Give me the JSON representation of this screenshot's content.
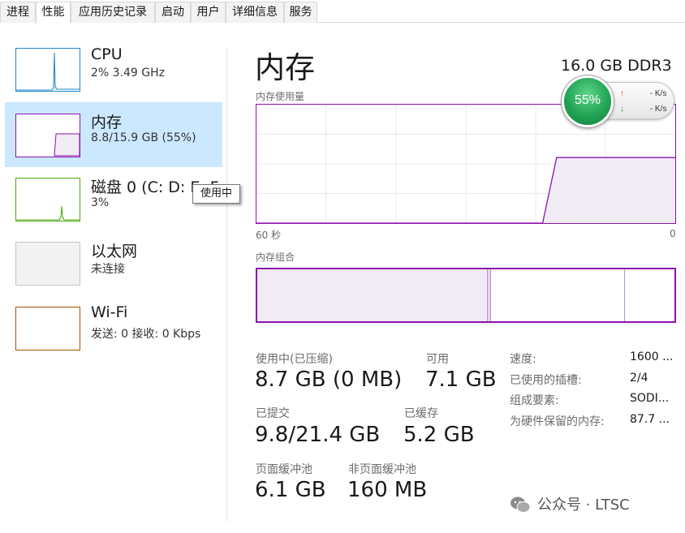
{
  "tabs": [
    {
      "label": "进程",
      "active": false
    },
    {
      "label": "性能",
      "active": true
    },
    {
      "label": "应用历史记录",
      "active": false
    },
    {
      "label": "启动",
      "active": false
    },
    {
      "label": "用户",
      "active": false
    },
    {
      "label": "详细信息",
      "active": false
    },
    {
      "label": "服务",
      "active": false
    }
  ],
  "sidebar": {
    "items": [
      {
        "title": "CPU",
        "sub": "2%  3.49 GHz",
        "color": "#1a86c8",
        "selected": false
      },
      {
        "title": "内存",
        "sub": "8.8/15.9 GB (55%)",
        "color": "#8b12ae",
        "selected": true
      },
      {
        "title": "磁盘 0 (C: D: E: F:",
        "sub": "3%",
        "color": "#4da60c",
        "selected": false
      },
      {
        "title": "以太网",
        "sub": "未连接",
        "color": "#a0a0a0",
        "selected": false
      },
      {
        "title": "Wi-Fi",
        "sub": "发送: 0 接收: 0 Kbps",
        "color": "#a74f01",
        "selected": false
      }
    ]
  },
  "tooltip": "使用中",
  "main": {
    "title": "内存",
    "spec": "16.0 GB DDR3",
    "usage_label": "内存使用量",
    "axis_left": "60 秒",
    "axis_right": "0",
    "composition_label": "内存组合",
    "accent_color": "#8b12ae"
  },
  "chart_data": {
    "type": "area",
    "title": "内存使用量",
    "xlabel": "",
    "ylabel": "",
    "x_range_labels": [
      "60 秒",
      "0"
    ],
    "ylim": [
      0,
      15.9
    ],
    "series": [
      {
        "x": [
          60,
          19,
          17,
          9,
          0
        ],
        "values": [
          0,
          0,
          8.8,
          8.8,
          8.8
        ]
      }
    ],
    "grid": true
  },
  "composition": {
    "in_use_fraction": 0.55,
    "modified_fraction": 0.01,
    "standby_fraction": 0.32,
    "free_fraction": 0.12
  },
  "stats": {
    "in_use_label": "使用中(已压缩)",
    "in_use_value": "8.7 GB (0 MB)",
    "available_label": "可用",
    "available_value": "7.1 GB",
    "committed_label": "已提交",
    "committed_value": "9.8/21.4 GB",
    "cached_label": "已缓存",
    "cached_value": "5.2 GB",
    "paged_label": "页面缓冲池",
    "paged_value": "6.1 GB",
    "nonpaged_label": "非页面缓冲池",
    "nonpaged_value": "160 MB"
  },
  "details": [
    {
      "label": "速度:",
      "value": "1600 ..."
    },
    {
      "label": "已使用的插槽:",
      "value": "2/4"
    },
    {
      "label": "组成要素:",
      "value": "SODI..."
    },
    {
      "label": "为硬件保留的内存:",
      "value": "87.7 ..."
    }
  ],
  "gauge": {
    "percent": "55%",
    "up_value": "- K/s",
    "down_value": "- K/s",
    "up_arrow": "↑",
    "down_arrow": "↓"
  },
  "watermark": "公众号 · LTSC"
}
